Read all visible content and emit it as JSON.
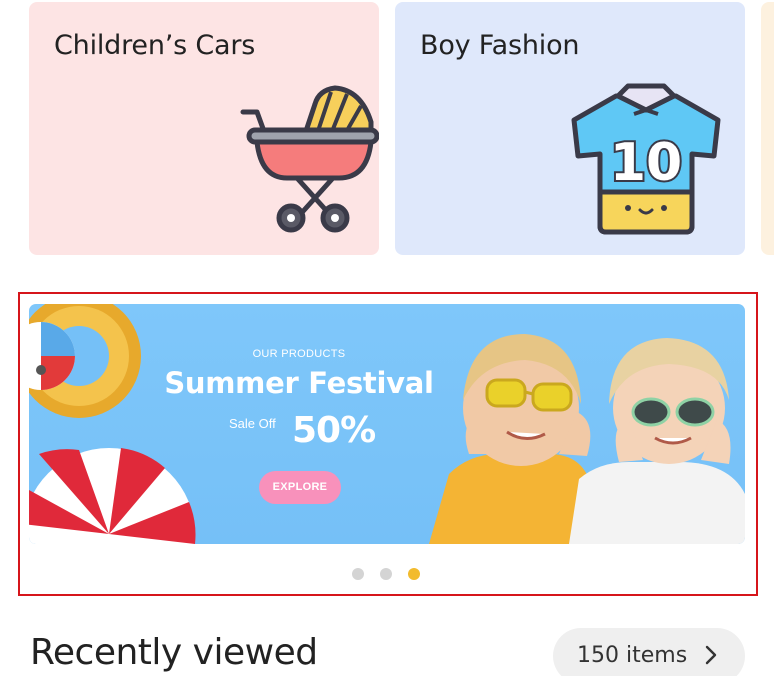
{
  "categories": [
    {
      "title": "Children’s Cars",
      "icon": "baby-stroller-icon",
      "bg": "#fde4e4"
    },
    {
      "title": "Boy Fashion",
      "icon": "football-jersey-icon",
      "bg": "#dfe8fb",
      "jersey_number": "10"
    }
  ],
  "banner": {
    "eyebrow": "OUR PRODUCTS",
    "title": "Summer Festival",
    "sale_label": "Sale Off",
    "sale_value": "50%",
    "button_label": "EXPLORE",
    "bg": "#7fc7fa",
    "button_color": "#f891bb"
  },
  "carousel": {
    "slide_count": 3,
    "active_index": 3,
    "active_color": "#f2bb2e"
  },
  "recently_viewed": {
    "title": "Recently viewed",
    "count_label": "150 items"
  }
}
